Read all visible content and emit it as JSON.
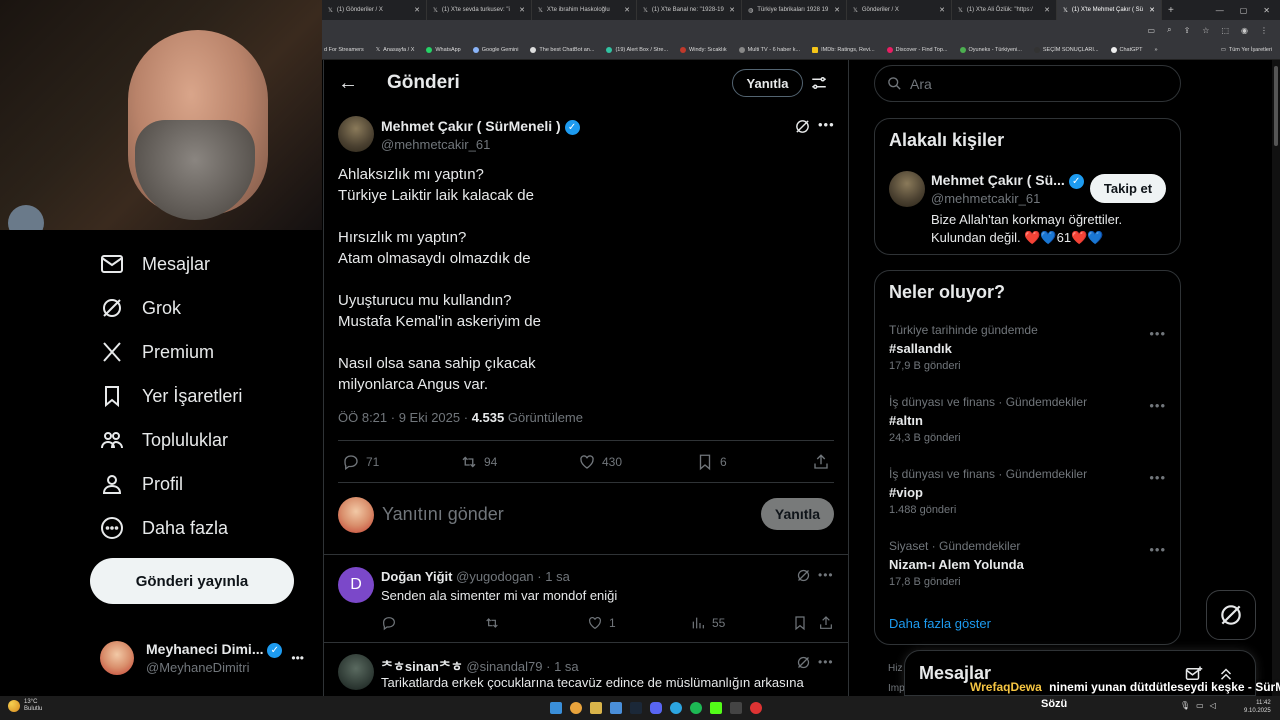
{
  "browser": {
    "tabs": [
      {
        "label": "(1) Gönderiler / X",
        "active": false
      },
      {
        "label": "(1) X'te sevda turkusev: \"i",
        "active": false
      },
      {
        "label": "X'te ibrahim Haskoloğlu",
        "active": false
      },
      {
        "label": "(1) X'te Banal ne: \"1928-19",
        "active": false
      },
      {
        "label": "Türkiye fabrikaları 1928 19",
        "active": false
      },
      {
        "label": "Gönderiler / X",
        "active": false
      },
      {
        "label": "(1) X'te Ali Özlük: \"https:/",
        "active": false
      },
      {
        "label": "(1) X'te Mehmet Çakır ( Sü",
        "active": true
      }
    ],
    "bookmarks": [
      "d For Streamers",
      "Anasayfa / X",
      "WhatsApp",
      "Google Gemini",
      "The best ChatBot an...",
      "(19) Alert Box / Stre...",
      "Windy: Sıcaklık",
      "Multi TV - 6 haber k...",
      "IMDb: Ratings, Revi...",
      "Discover - Find Top...",
      "Oyuneks - Türkiyeni...",
      "SEÇİM SONUÇLARI...",
      "ChatGPT"
    ],
    "bookmarks_more": "»",
    "bookmarks_all": "Tüm Yer İşaretleri"
  },
  "sidebar": {
    "items": [
      {
        "label": "Mesajlar",
        "icon": "mail-icon"
      },
      {
        "label": "Grok",
        "icon": "grok-icon"
      },
      {
        "label": "Premium",
        "icon": "x-logo-icon"
      },
      {
        "label": "Yer İşaretleri",
        "icon": "bookmark-icon"
      },
      {
        "label": "Topluluklar",
        "icon": "communities-icon"
      },
      {
        "label": "Profil",
        "icon": "profile-icon"
      },
      {
        "label": "Daha fazla",
        "icon": "more-circle-icon"
      }
    ],
    "post_button": "Gönderi yayınla",
    "account": {
      "name": "Meyhaneci Dimi...",
      "handle": "@MeyhaneDimitri",
      "more": "•••"
    }
  },
  "main": {
    "header": {
      "back": "←",
      "title": "Gönderi",
      "reply_button": "Yanıtla"
    },
    "post": {
      "author": "Mehmet Çakır ( SürMeneli )",
      "handle": "@mehmetcakir_61",
      "lines": [
        "Ahlaksızlık mı yaptın?",
        "Türkiye Laiktir laik kalacak de",
        "",
        "Hırsızlık mı yaptın?",
        "Atam olmasaydı olmazdık de",
        "",
        "Uyuşturucu mu kullandın?",
        "Mustafa Kemal'in askeriyim de",
        "",
        "Nasıl olsa sana sahip çıkacak",
        "milyonlarca Angus var."
      ],
      "timestamp": "ÖÖ 8:21 · 9 Eki 2025 · ",
      "views": "4.535",
      "views_label": " Görüntüleme",
      "stats": {
        "replies": "71",
        "reposts": "94",
        "likes": "430",
        "bookmarks": "6"
      }
    },
    "composer": {
      "placeholder": "Yanıtını gönder",
      "button": "Yanıtla"
    },
    "replies": [
      {
        "name": "Doğan Yiğit",
        "handle": "@yugodogan",
        "time": "· 1 sa",
        "avatar_letter": "D",
        "text": "Senden ala simenter mi var mondof eniği",
        "stats": {
          "replies": "",
          "reposts": "",
          "likes": "1",
          "views": "55"
        }
      },
      {
        "name": "ᄎㅎsinanᄎㅎ",
        "handle": "@sinandal79",
        "time": "· 1 sa",
        "text": "Tarikatlarda erkek çocuklarına tecavüz edince de müslümanlığın arkasına"
      }
    ]
  },
  "right": {
    "search_placeholder": "Ara",
    "related": {
      "title": "Alakalı kişiler",
      "name": "Mehmet Çakır ( Sü...",
      "handle": "@mehmetcakir_61",
      "follow": "Takip et",
      "bio": "Bize Allah'tan korkmayı öğrettiler. Kulundan değil. ❤️💙61❤️💙"
    },
    "trends": {
      "title": "Neler oluyor?",
      "items": [
        {
          "category": "Türkiye tarihinde gündemde",
          "name": "#sallandık",
          "count": "17,9 B gönderi"
        },
        {
          "category": "İş dünyası ve finans · Gündemdekiler",
          "name": "#altın",
          "count": "24,3 B gönderi"
        },
        {
          "category": "İş dünyası ve finans · Gündemdekiler",
          "name": "#viop",
          "count": "1.488 gönderi"
        },
        {
          "category": "Siyaset · Gündemdekiler",
          "name": "Nizam-ı Alem Yolunda",
          "count": "17,8 B gönderi"
        }
      ],
      "show_more": "Daha fazla göster"
    },
    "messages_drawer": {
      "title": "Mesajlar"
    },
    "footer_partial": [
      "Hiz",
      "Imp"
    ]
  },
  "overlay": {
    "ticker_user": "WrefaqDewa",
    "ticker_text": "ninemi yunan dütdütleseydi keşke - SürMeneli",
    "ticker_line2": "Sözü"
  },
  "taskbar": {
    "weather_temp": "13°C",
    "weather_desc": "Bulutlu",
    "time": "11:42",
    "date": "9.10.2025"
  },
  "colors": {
    "accent": "#1d9bf0",
    "background": "#000000",
    "border": "#2f3336",
    "muted": "#71767b",
    "heart": "#f91880"
  }
}
